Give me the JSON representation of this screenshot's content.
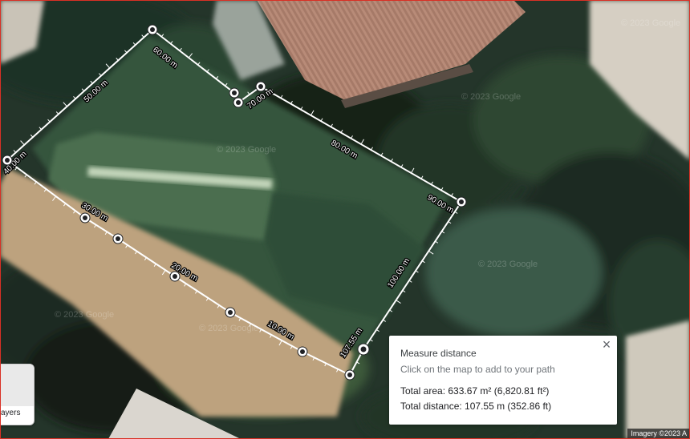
{
  "colors": {
    "frame": "#d93025",
    "ruler_line": "#ffffff",
    "ruler_node": "#ffffff",
    "ruler_node_center": "#202124"
  },
  "map": {
    "watermark": "© 2023 Google",
    "imagery_attribution": "Imagery ©2023 A"
  },
  "ruler": {
    "labels": [
      "60.00 m",
      "50.00 m",
      "70.00 m",
      "80.00 m",
      "40.00 m",
      "90.00 m",
      "30.00 m",
      "100.00 m",
      "20.00 m",
      "10.00 m",
      "107.55 m"
    ]
  },
  "measure_panel": {
    "title": "Measure distance",
    "hint": "Click on the map to add to your path",
    "total_area": "Total area: 633.67 m² (6,820.81 ft²)",
    "total_distance": "Total distance: 107.55 m (352.86 ft)",
    "close_icon": "close-icon"
  },
  "layers_control": {
    "label": "ayers"
  }
}
